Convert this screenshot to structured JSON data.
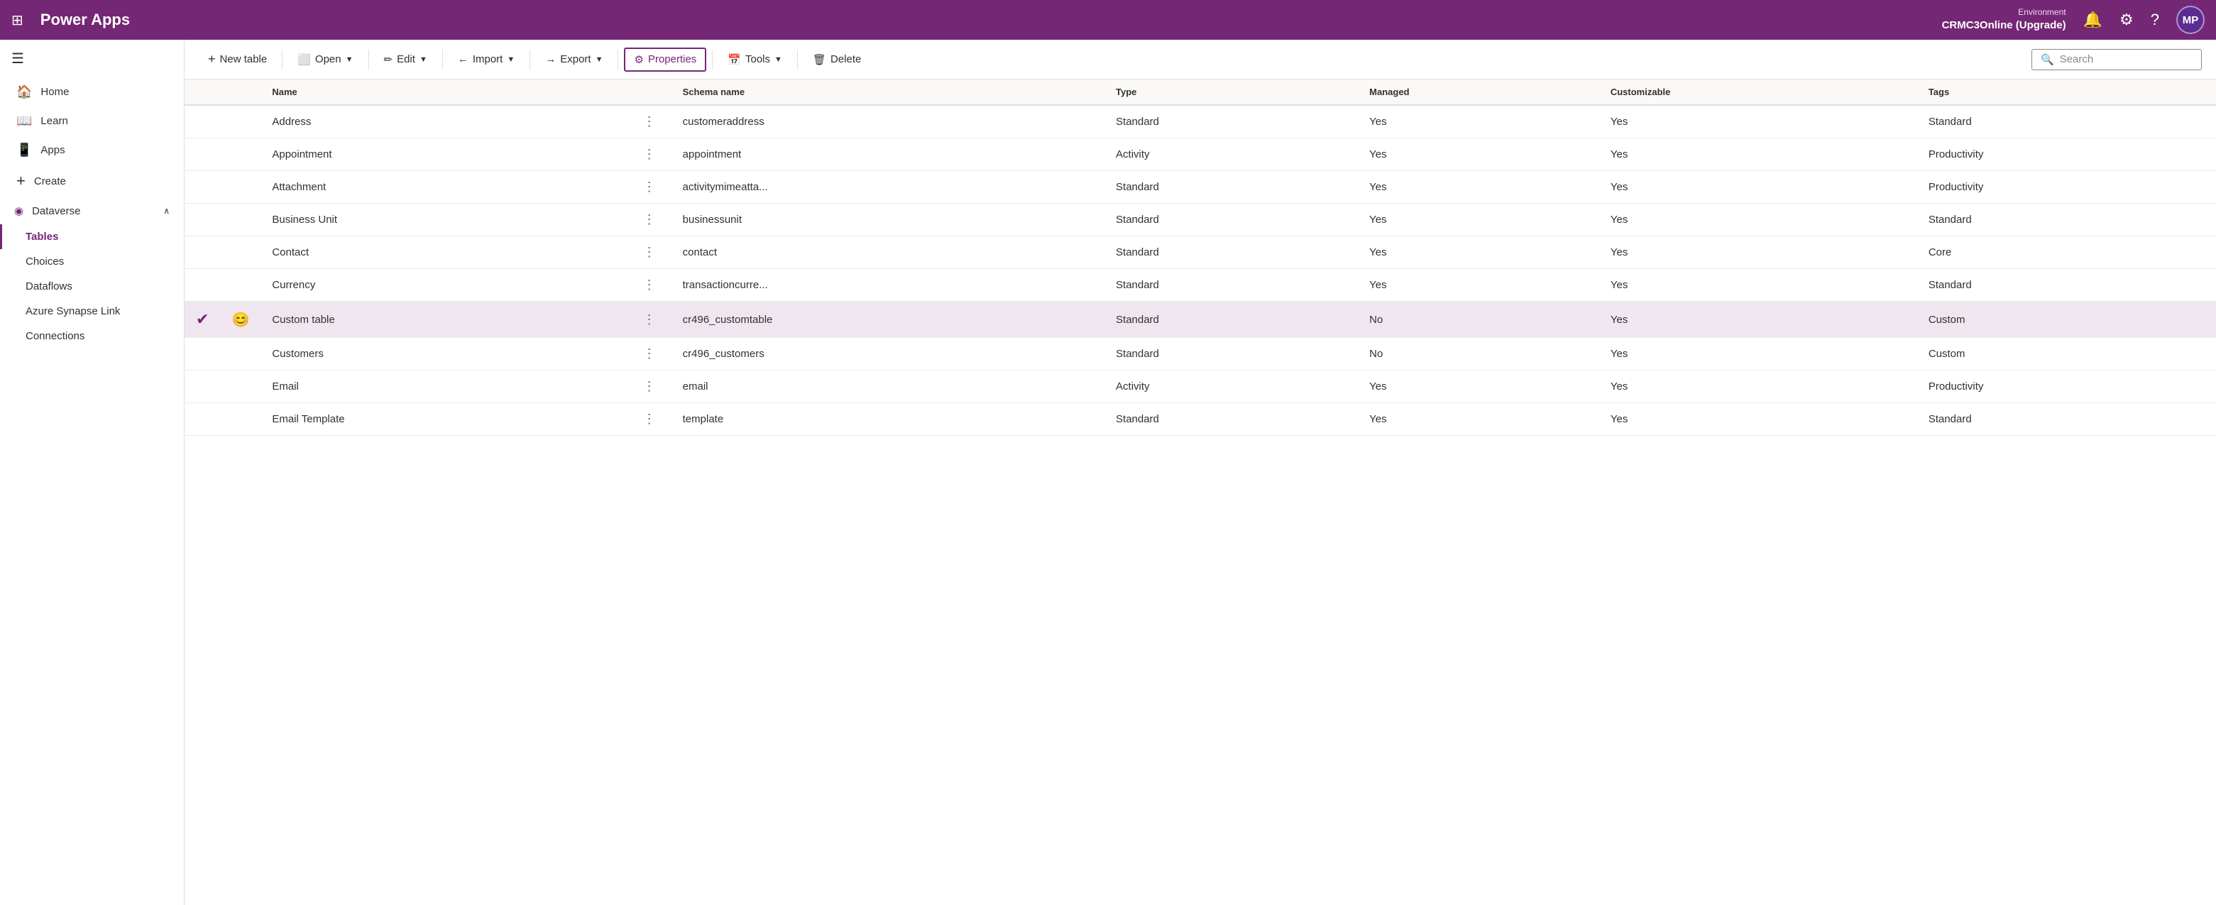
{
  "topbar": {
    "grid_icon": "⊞",
    "logo": "Power Apps",
    "env_label": "Environment",
    "env_name": "CRMC3Online (Upgrade)",
    "bell_icon": "🔔",
    "settings_icon": "⚙",
    "help_icon": "?",
    "avatar_label": "MP"
  },
  "sidebar": {
    "hamburger_icon": "☰",
    "items": [
      {
        "id": "home",
        "icon": "🏠",
        "label": "Home"
      },
      {
        "id": "learn",
        "icon": "📖",
        "label": "Learn"
      },
      {
        "id": "apps",
        "icon": "📱",
        "label": "Apps"
      },
      {
        "id": "create",
        "icon": "+",
        "label": "Create"
      },
      {
        "id": "dataverse",
        "icon": "◉",
        "label": "Dataverse",
        "expanded": true,
        "chevron": "∧"
      }
    ],
    "sub_items": [
      {
        "id": "tables",
        "label": "Tables",
        "active": true
      },
      {
        "id": "choices",
        "label": "Choices"
      },
      {
        "id": "dataflows",
        "label": "Dataflows"
      },
      {
        "id": "azure-synapse",
        "label": "Azure Synapse Link"
      },
      {
        "id": "connections",
        "label": "Connections"
      }
    ]
  },
  "toolbar": {
    "new_table_label": "New table",
    "open_label": "Open",
    "edit_label": "Edit",
    "import_label": "Import",
    "export_label": "Export",
    "properties_label": "Properties",
    "tools_label": "Tools",
    "delete_label": "Delete",
    "search_placeholder": "Search",
    "new_icon": "+",
    "open_icon": "⬜",
    "edit_icon": "✏",
    "import_icon": "←",
    "export_icon": "→",
    "properties_icon": "⚙",
    "tools_icon": "📅",
    "delete_icon": "🗑",
    "search_icon": "🔍"
  },
  "table": {
    "columns": [
      "Name",
      "",
      "Schema name",
      "Type",
      "Managed",
      "Customizable",
      "Tags"
    ],
    "rows": [
      {
        "id": 1,
        "name": "Address",
        "dots": true,
        "schema": "customeraddress",
        "type": "Standard",
        "managed": "Yes",
        "customizable": "Yes",
        "tags": "Standard",
        "selected": false
      },
      {
        "id": 2,
        "name": "Appointment",
        "dots": true,
        "schema": "appointment",
        "type": "Activity",
        "managed": "Yes",
        "customizable": "Yes",
        "tags": "Productivity",
        "selected": false
      },
      {
        "id": 3,
        "name": "Attachment",
        "dots": true,
        "schema": "activitymimeatta...",
        "type": "Standard",
        "managed": "Yes",
        "customizable": "Yes",
        "tags": "Productivity",
        "selected": false
      },
      {
        "id": 4,
        "name": "Business Unit",
        "dots": true,
        "schema": "businessunit",
        "type": "Standard",
        "managed": "Yes",
        "customizable": "Yes",
        "tags": "Standard",
        "selected": false
      },
      {
        "id": 5,
        "name": "Contact",
        "dots": true,
        "schema": "contact",
        "type": "Standard",
        "managed": "Yes",
        "customizable": "Yes",
        "tags": "Core",
        "selected": false
      },
      {
        "id": 6,
        "name": "Currency",
        "dots": true,
        "schema": "transactioncurre...",
        "type": "Standard",
        "managed": "Yes",
        "customizable": "Yes",
        "tags": "Standard",
        "selected": false
      },
      {
        "id": 7,
        "name": "Custom table",
        "dots": true,
        "schema": "cr496_customtable",
        "type": "Standard",
        "managed": "No",
        "customizable": "Yes",
        "tags": "Custom",
        "selected": true,
        "check": true,
        "emoji": "😊"
      },
      {
        "id": 8,
        "name": "Customers",
        "dots": true,
        "schema": "cr496_customers",
        "type": "Standard",
        "managed": "No",
        "customizable": "Yes",
        "tags": "Custom",
        "selected": false
      },
      {
        "id": 9,
        "name": "Email",
        "dots": true,
        "schema": "email",
        "type": "Activity",
        "managed": "Yes",
        "customizable": "Yes",
        "tags": "Productivity",
        "selected": false
      },
      {
        "id": 10,
        "name": "Email Template",
        "dots": true,
        "schema": "template",
        "type": "Standard",
        "managed": "Yes",
        "customizable": "Yes",
        "tags": "Standard",
        "selected": false
      }
    ]
  }
}
